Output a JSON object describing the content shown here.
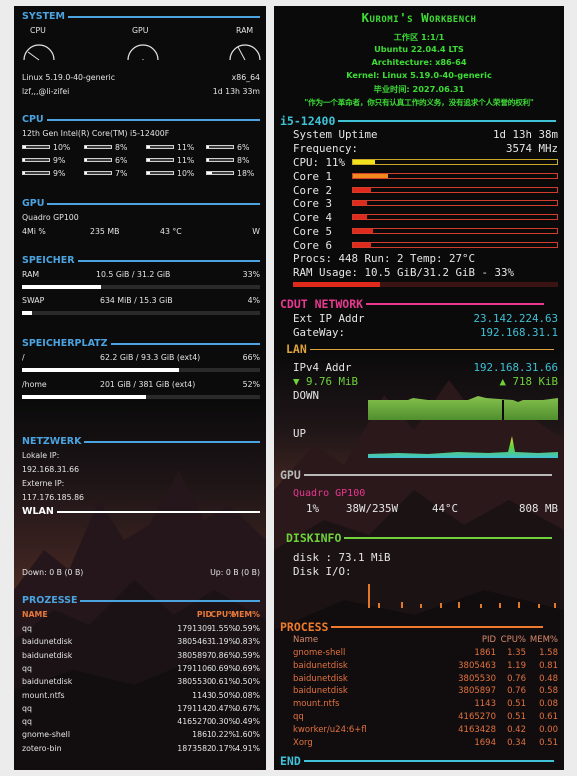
{
  "left": {
    "system": {
      "title": "SYSTEM",
      "gauges": [
        "CPU",
        "GPU",
        "RAM"
      ],
      "kernel": "Linux 5.19.0-40-generic",
      "arch": "x86_64",
      "user": "lzf,,,@li-zifei",
      "uptime": "1d 13h 33m"
    },
    "cpu": {
      "title": "CPU",
      "model": "12th Gen Intel(R) Core(TM) i5-12400F",
      "cores": [
        {
          "label": "10%",
          "value": 0.1
        },
        {
          "label": "8%",
          "value": 0.08
        },
        {
          "label": "11%",
          "value": 0.11
        },
        {
          "label": "6%",
          "value": 0.06
        },
        {
          "label": "9%",
          "value": 0.09
        },
        {
          "label": "6%",
          "value": 0.06
        },
        {
          "label": "11%",
          "value": 0.11
        },
        {
          "label": "8%",
          "value": 0.08
        },
        {
          "label": "9%",
          "value": 0.09
        },
        {
          "label": "7%",
          "value": 0.07
        },
        {
          "label": "10%",
          "value": 0.1
        },
        {
          "label": "18%",
          "value": 0.18
        }
      ]
    },
    "gpu": {
      "title": "GPU",
      "name": "Quadro GP100",
      "util": "4Mi %",
      "mem": "235 MB",
      "temp": "43 °C",
      "power": "W"
    },
    "speicher": {
      "title": "SPEICHER",
      "ram_label": "RAM",
      "ram_value": "10.5 GiB / 31.2 GiB",
      "ram_pct": "33%",
      "ram_fill": 0.33,
      "swap_label": "SWAP",
      "swap_value": "634 MiB / 15.3 GiB",
      "swap_pct": "4%",
      "swap_fill": 0.04
    },
    "speicherplatz": {
      "title": "SPEICHERPLATZ",
      "root_label": "/",
      "root_value": "62.2 GiB / 93.3 GiB (ext4)",
      "root_pct": "66%",
      "root_fill": 0.66,
      "home_label": "/home",
      "home_value": "201 GiB / 381 GiB (ext4)",
      "home_pct": "52%",
      "home_fill": 0.52
    },
    "netzwerk": {
      "title": "NETZWERK",
      "local_label": "Lokale IP:",
      "local_ip": "192.168.31.66",
      "ext_label": "Externe IP:",
      "ext_ip": "117.176.185.86",
      "wlan_title": "WLAN",
      "down": "Down: 0 B (0 B)",
      "up": "Up: 0 B (0 B)"
    },
    "prozesse": {
      "title": "PROZESSE",
      "headers": [
        "NAME",
        "PID",
        "CPU%",
        "MEM%"
      ],
      "rows": [
        [
          "qq",
          "1791309",
          "1.55%",
          "0.59%"
        ],
        [
          "baidunetdisk",
          "3805463",
          "1.19%",
          "0.83%"
        ],
        [
          "baidunetdisk",
          "3805897",
          "0.86%",
          "0.59%"
        ],
        [
          "qq",
          "1791106",
          "0.69%",
          "0.69%"
        ],
        [
          "baidunetdisk",
          "3805530",
          "0.61%",
          "0.50%"
        ],
        [
          "mount.ntfs",
          "1143",
          "0.50%",
          "0.08%"
        ],
        [
          "qq",
          "1791142",
          "0.47%",
          "0.67%"
        ],
        [
          "qq",
          "4165270",
          "0.30%",
          "0.49%"
        ],
        [
          "gnome-shell",
          "1861",
          "0.22%",
          "1.60%"
        ],
        [
          "zotero-bin",
          "1873582",
          "0.17%",
          "4.91%"
        ]
      ]
    }
  },
  "right": {
    "header": {
      "title": "Kuromi's Workbench",
      "workspace": "工作区 1:1/1",
      "os": "Ubuntu 22.04.4 LTS",
      "arch": "Architecture: x86-64",
      "kernel": "Kernel: Linux 5.19.0-40-generic",
      "grad": "毕业时间: 2027.06.31",
      "quote": "\"作为一个革命者，你只有认真工作的义务，没有追求个人荣誉的权利\""
    },
    "cpu": {
      "title": "i5-12400",
      "uptime_label": "System Uptime",
      "uptime": "1d 13h 38m",
      "freq_label": "Frequency:",
      "freq": "3574 MHz",
      "total_label": "CPU: 11%",
      "total_fill": 0.11,
      "cores": [
        {
          "label": "Core 1",
          "value": 0.17
        },
        {
          "label": "Core 2",
          "value": 0.09
        },
        {
          "label": "Core 3",
          "value": 0.07
        },
        {
          "label": "Core 4",
          "value": 0.07
        },
        {
          "label": "Core 5",
          "value": 0.1
        },
        {
          "label": "Core 6",
          "value": 0.09
        }
      ],
      "procs_line": "Procs: 448  Run: 2 Temp: 27°C",
      "ram_line": "RAM Usage: 10.5 GiB/31.2 GiB - 33%",
      "ram_fill": 0.33
    },
    "network": {
      "title": "CDUT NETWORK",
      "ext_label": "Ext IP Addr",
      "ext_ip": "23.142.224.63",
      "gw_label": "GateWay:",
      "gw": "192.168.31.1",
      "lan_title": "LAN",
      "ipv4_label": "IPv4 Addr",
      "ipv4": "192.168.31.66",
      "down_rate": "▼ 9.76 MiB",
      "up_rate": "▲ 718 KiB",
      "down_label": "DOWN",
      "up_label": "UP"
    },
    "gpu": {
      "title": "GPU",
      "name": "Quadro GP100",
      "util": "1%",
      "power": "38W/235W",
      "temp": "44°C",
      "mem": "808 MB"
    },
    "disk": {
      "title": "DISKINFO",
      "disk_line": "disk : 73.1 MiB",
      "io_label": "Disk I/O:"
    },
    "process": {
      "title": "PROCESS",
      "headers": [
        "Name",
        "PID",
        "CPU%",
        "MEM%"
      ],
      "rows": [
        [
          "gnome-shell",
          "1861",
          "1.35",
          "1.58"
        ],
        [
          "baidunetdisk",
          "3805463",
          "1.19",
          "0.81"
        ],
        [
          "baidunetdisk",
          "3805530",
          "0.76",
          "0.48"
        ],
        [
          "baidunetdisk",
          "3805897",
          "0.76",
          "0.58"
        ],
        [
          "mount.ntfs",
          "1143",
          "0.51",
          "0.08"
        ],
        [
          "qq",
          "4165270",
          "0.51",
          "0.61"
        ],
        [
          "kworker/u24:6+fl",
          "4163428",
          "0.42",
          "0.00"
        ],
        [
          "Xorg",
          "1694",
          "0.34",
          "0.51"
        ]
      ],
      "end_label": "END"
    }
  },
  "colors": {
    "left_accent": "#4ba3e0",
    "left_proc": "#e8793a",
    "header_green": "#3ddc35",
    "cyan": "#3fc1d6",
    "pink": "#e8388f",
    "lan_orange": "#e0a23a",
    "red": "#e02a1c",
    "green_section": "#6fd23a",
    "orange_section": "#f07a2b",
    "gray_section": "#b8b8b8"
  }
}
